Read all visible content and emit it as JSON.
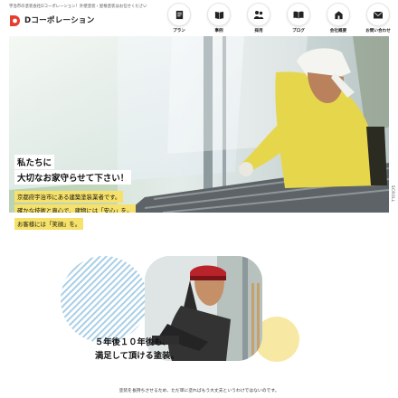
{
  "header": {
    "tagline": "宇治市の塗装会社Dコーポレーション！外壁塗装・屋根塗装はお任せください",
    "logo_text": "Dコーポレーション",
    "nav": [
      {
        "label": "プラン",
        "icon": "document-icon"
      },
      {
        "label": "事例",
        "icon": "book-icon"
      },
      {
        "label": "採用",
        "icon": "people-icon"
      },
      {
        "label": "ブログ",
        "icon": "open-book-icon"
      },
      {
        "label": "会社概要",
        "icon": "building-icon"
      },
      {
        "label": "お問い合わせ",
        "icon": "mail-icon"
      }
    ]
  },
  "hero": {
    "line1": "私たちに",
    "line2": "大切なお家守らせて下さい！",
    "sub1": "京都府宇治市にある建築塗装業者です。",
    "sub2": "確かな技術と真心で、建物には「安心」を。",
    "sub3": "お客様には「笑顔」を。",
    "scroll_label": "SCROLL"
  },
  "lower": {
    "copy1": "５年後１０年後も、",
    "copy2": "満足して頂ける塗装。",
    "bottom_text": "塗装を長持ちさせるため、ただ単に塗ればもう大丈夫というわけではないのです。"
  },
  "colors": {
    "accent_red": "#e53d2f",
    "highlight_yellow": "#f6e26b",
    "pattern_blue": "#a9cfe6",
    "circle_yellow": "#f7e9a3"
  }
}
